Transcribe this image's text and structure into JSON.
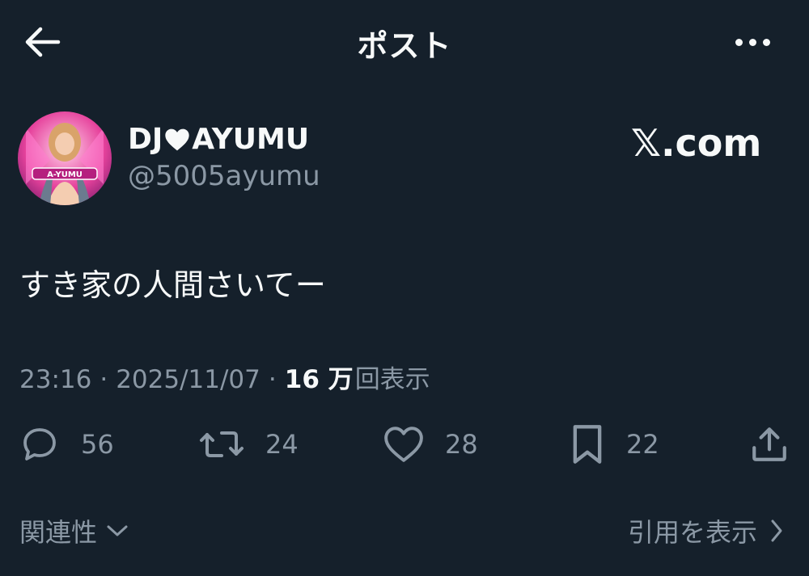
{
  "header": {
    "title": "ポスト",
    "back_icon": "arrow-left-icon",
    "more_icon": "more-horizontal-icon"
  },
  "author": {
    "name_part1": "DJ",
    "name_part2": "AYUMU",
    "name_heart_icon": "heart-icon",
    "handle": "@5005ayumu",
    "avatar_text": "A-YUMU",
    "avatar_icon": "avatar-photo"
  },
  "watermark": {
    "logo_letter": "𝕏",
    "text": ".com"
  },
  "post": {
    "text": "すき家の人間さいてー",
    "time": "23:16",
    "date": "2025/11/07",
    "views_count": "16 万",
    "views_label": "回表示",
    "separator": "·"
  },
  "actions": {
    "reply_count": "56",
    "repost_count": "24",
    "like_count": "28",
    "bookmark_count": "22"
  },
  "footer": {
    "related_label": "関連性",
    "quotes_label": "引用を表示"
  },
  "colors": {
    "background": "#15202b",
    "text": "#f7f9f9",
    "secondary": "#8b98a5",
    "avatar_pink": "#e6429c"
  }
}
